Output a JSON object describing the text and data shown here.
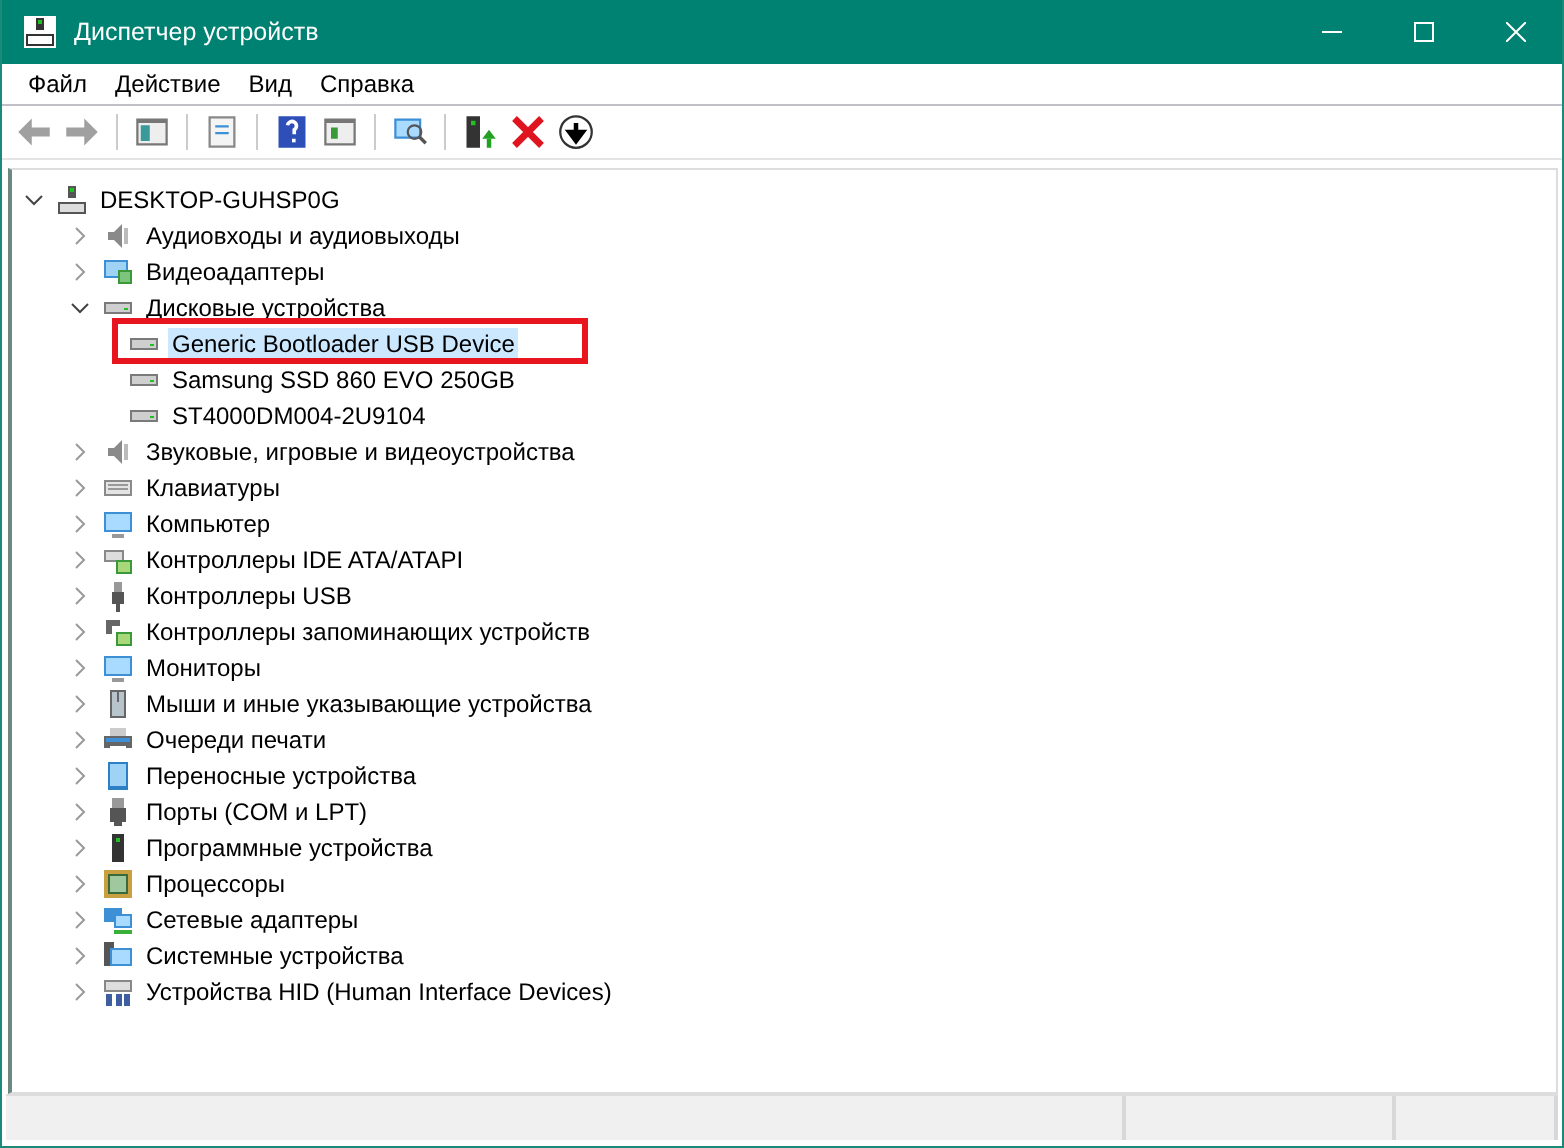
{
  "window": {
    "title": "Диспетчер устройств"
  },
  "menu": [
    "Файл",
    "Действие",
    "Вид",
    "Справка"
  ],
  "toolbar": {
    "back_disabled": true,
    "forward_disabled": true
  },
  "tree": {
    "label": "DESKTOP-GUHSP0G",
    "expanded": true,
    "children": [
      {
        "label": "Аудиовходы и аудиовыходы",
        "expanded": false
      },
      {
        "label": "Видеоадаптеры",
        "expanded": false
      },
      {
        "label": "Дисковые устройства",
        "expanded": true,
        "children": [
          {
            "label": "Generic Bootloader USB Device",
            "selected": true,
            "highlighted": true
          },
          {
            "label": "Samsung SSD 860 EVO 250GB",
            "selected": false,
            "highlighted": false
          },
          {
            "label": "ST4000DM004-2U9104",
            "selected": false,
            "highlighted": false
          }
        ]
      },
      {
        "label": "Звуковые, игровые и видеоустройства",
        "expanded": false
      },
      {
        "label": "Клавиатуры",
        "expanded": false
      },
      {
        "label": "Компьютер",
        "expanded": false
      },
      {
        "label": "Контроллеры IDE ATA/ATAPI",
        "expanded": false
      },
      {
        "label": "Контроллеры USB",
        "expanded": false
      },
      {
        "label": "Контроллеры запоминающих устройств",
        "expanded": false
      },
      {
        "label": "Мониторы",
        "expanded": false
      },
      {
        "label": "Мыши и иные указывающие устройства",
        "expanded": false
      },
      {
        "label": "Очереди печати",
        "expanded": false
      },
      {
        "label": "Переносные устройства",
        "expanded": false
      },
      {
        "label": "Порты (COM и LPT)",
        "expanded": false
      },
      {
        "label": "Программные устройства",
        "expanded": false
      },
      {
        "label": "Процессоры",
        "expanded": false
      },
      {
        "label": "Сетевые адаптеры",
        "expanded": false
      },
      {
        "label": "Системные устройства",
        "expanded": false
      },
      {
        "label": "Устройства HID (Human Interface Devices)",
        "expanded": false
      }
    ]
  }
}
